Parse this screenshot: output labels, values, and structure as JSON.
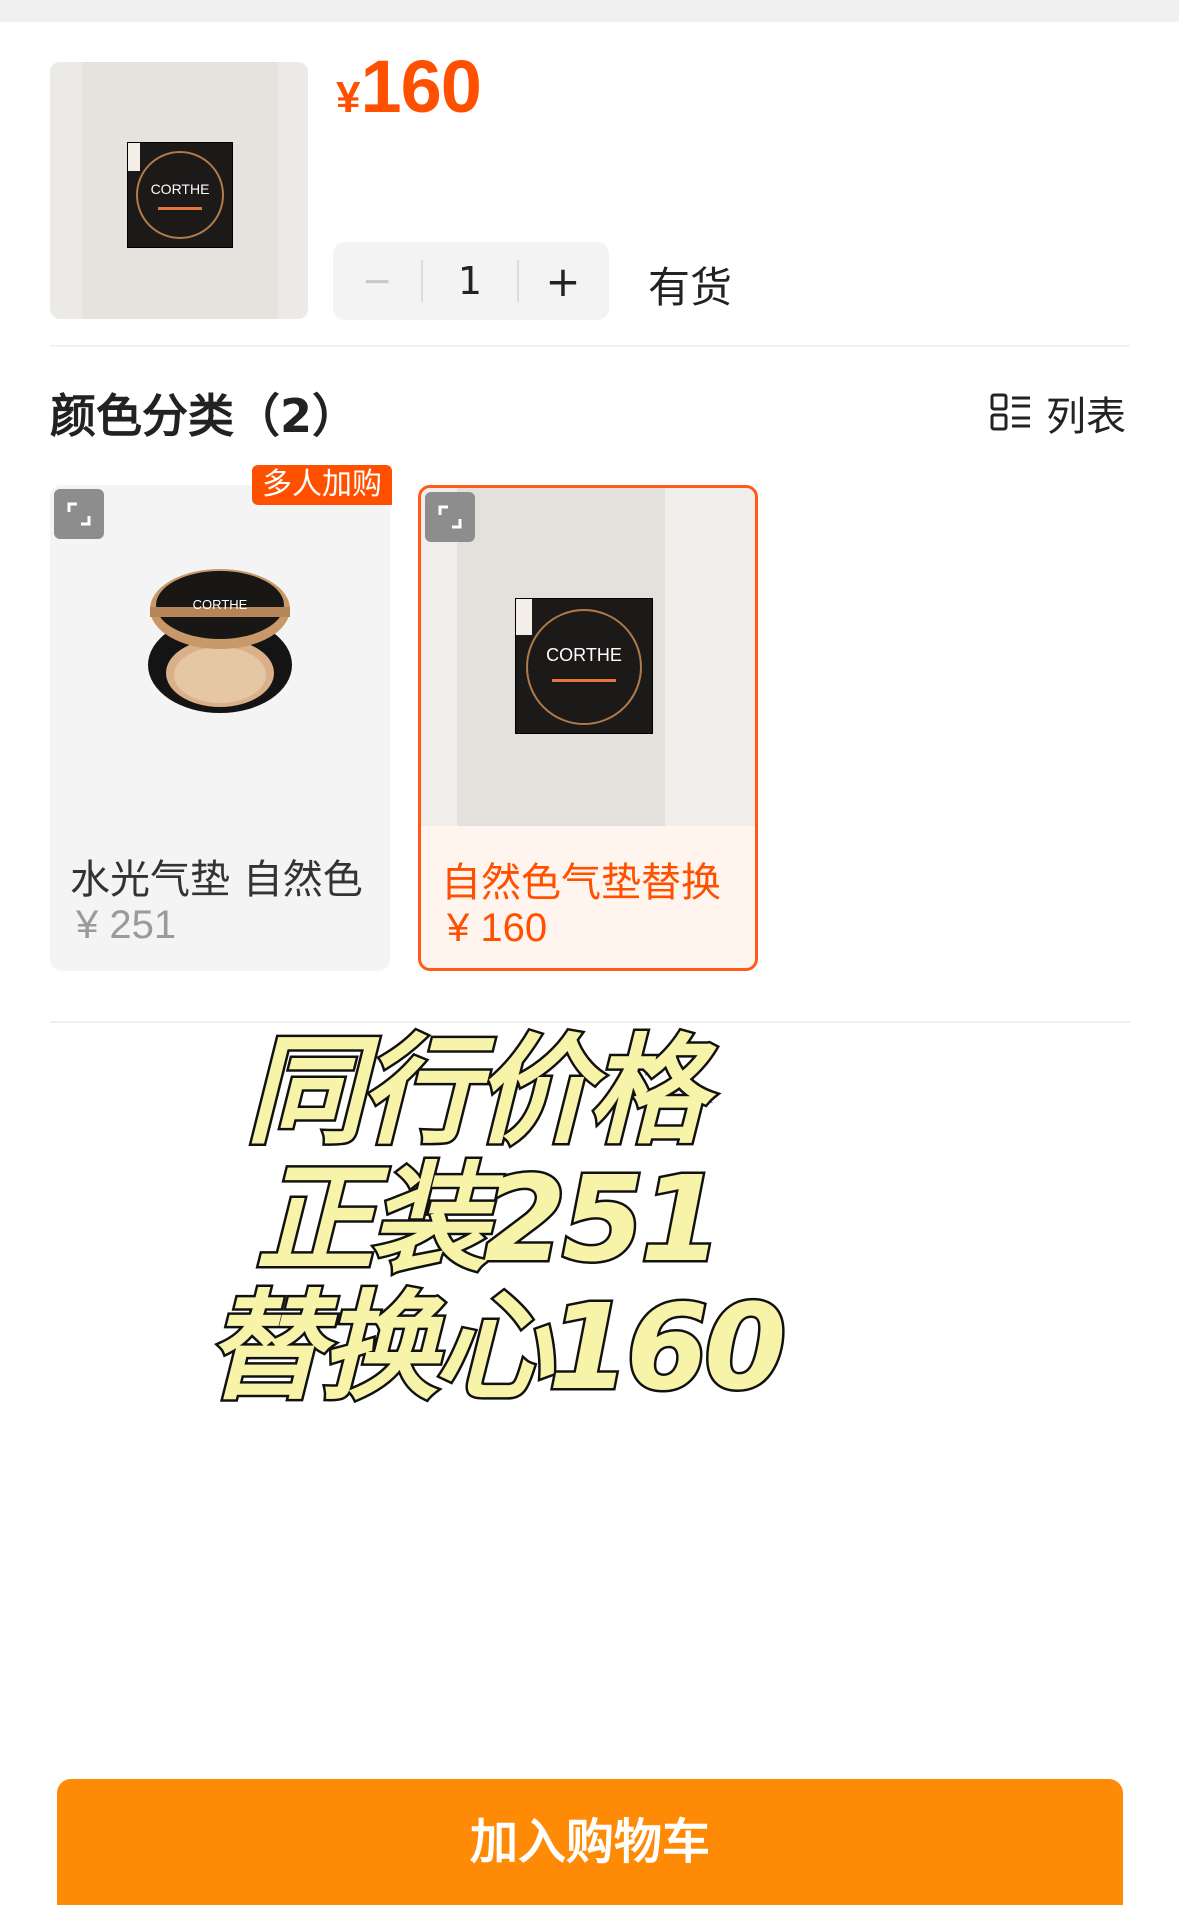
{
  "product": {
    "price_currency": "¥",
    "price_value": "160",
    "quantity": "1",
    "minus_label": "−",
    "plus_label": "+",
    "stock_status": "有货",
    "box_brand": "CORTHE"
  },
  "variants_section": {
    "title": "颜色分类（2）",
    "view_toggle_label": "列表",
    "view_toggle_icon": "list-view-icon"
  },
  "variants": [
    {
      "name": "水光气垫 自然色",
      "price": "¥ 251",
      "badge": "多人加购",
      "image_brand": "CORTHE",
      "selected": false
    },
    {
      "name": "自然色气垫替换",
      "price": "¥ 160",
      "image_brand": "CORTHE",
      "selected": true
    }
  ],
  "overlay_text": {
    "line1": "同行价格",
    "line2": "正装251",
    "line3": "替换心160"
  },
  "cta": {
    "add_to_cart": "加入购物车"
  },
  "colors": {
    "accent": "#ff5000",
    "cta": "#ff8a06",
    "overlay_fill": "#f7f3a8"
  }
}
